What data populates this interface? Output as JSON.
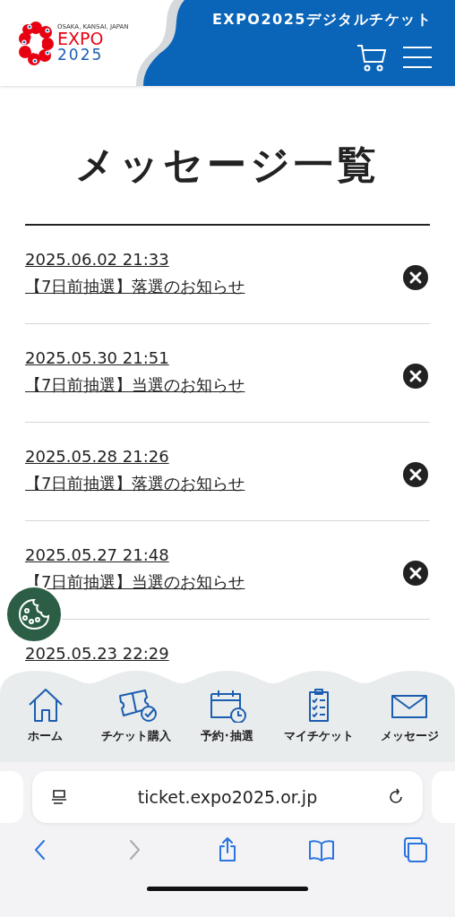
{
  "header": {
    "logo": {
      "caption": "OSAKA, KANSAI, JAPAN",
      "word": "EXPO",
      "year": "2025"
    },
    "title": "EXPO2025デジタルチケット"
  },
  "page_title": "メッセージ一覧",
  "messages": [
    {
      "date": "2025.06.02 21:33",
      "subject": "【7日前抽選】落選のお知らせ"
    },
    {
      "date": "2025.05.30 21:51",
      "subject": "【7日前抽選】当選のお知らせ"
    },
    {
      "date": "2025.05.28 21:26",
      "subject": "【7日前抽選】落選のお知らせ"
    },
    {
      "date": "2025.05.27 21:48",
      "subject": "【7日前抽選】当選のお知らせ"
    },
    {
      "date": "2025.05.23 22:29"
    }
  ],
  "bottom_nav": [
    {
      "kind": "home",
      "label": "ホーム"
    },
    {
      "kind": "ticket",
      "label": "チケット購入"
    },
    {
      "kind": "calendar",
      "label": "予約･抽選"
    },
    {
      "kind": "clipboard",
      "label": "マイチケット"
    },
    {
      "kind": "mail",
      "label": "メッセージ"
    }
  ],
  "browser": {
    "url": "ticket.expo2025.or.jp",
    "toolbar": [
      {
        "kind": "back",
        "disabled": false
      },
      {
        "kind": "forward",
        "disabled": true
      },
      {
        "kind": "share",
        "disabled": false
      },
      {
        "kind": "bookmarks",
        "disabled": false
      },
      {
        "kind": "tabs",
        "disabled": false
      }
    ]
  }
}
